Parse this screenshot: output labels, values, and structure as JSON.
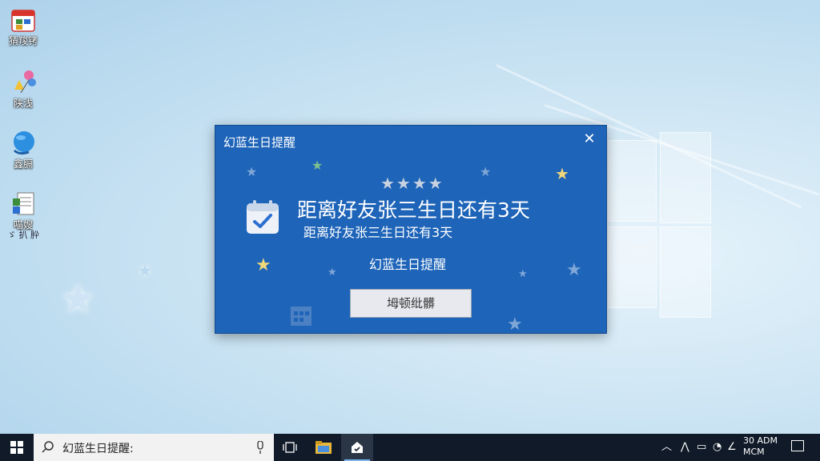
{
  "desktop": {
    "icons": [
      {
        "label": "猜羧铐",
        "icon": "calendar-app-icon"
      },
      {
        "label": "陕浅",
        "icon": "balloons-icon"
      },
      {
        "label": "鑫膈",
        "icon": "globe-icon"
      },
      {
        "label": "喵嫂",
        "sublabel": "ゞ 扒 肸",
        "icon": "document-icon"
      }
    ]
  },
  "dialog": {
    "title": "幻蓝生日提醒",
    "close_icon": "close-icon",
    "rating": "★★★★",
    "headline": "距离好友张三生日还有3天",
    "subline": "距离好友张三生日还有3天",
    "caption": "幻蓝生日提醒",
    "button_label": "坶顿纰髒",
    "colors": {
      "background": "#1e64b8",
      "button": "#e7e9ee"
    }
  },
  "taskbar": {
    "search_text": "幻蓝生日提醒:",
    "clock_time": "30 ADM",
    "clock_date": "MCM",
    "tray": [
      "chevron-up-icon",
      "network-icon",
      "battery-icon",
      "volume-icon",
      "ime-icon"
    ]
  }
}
